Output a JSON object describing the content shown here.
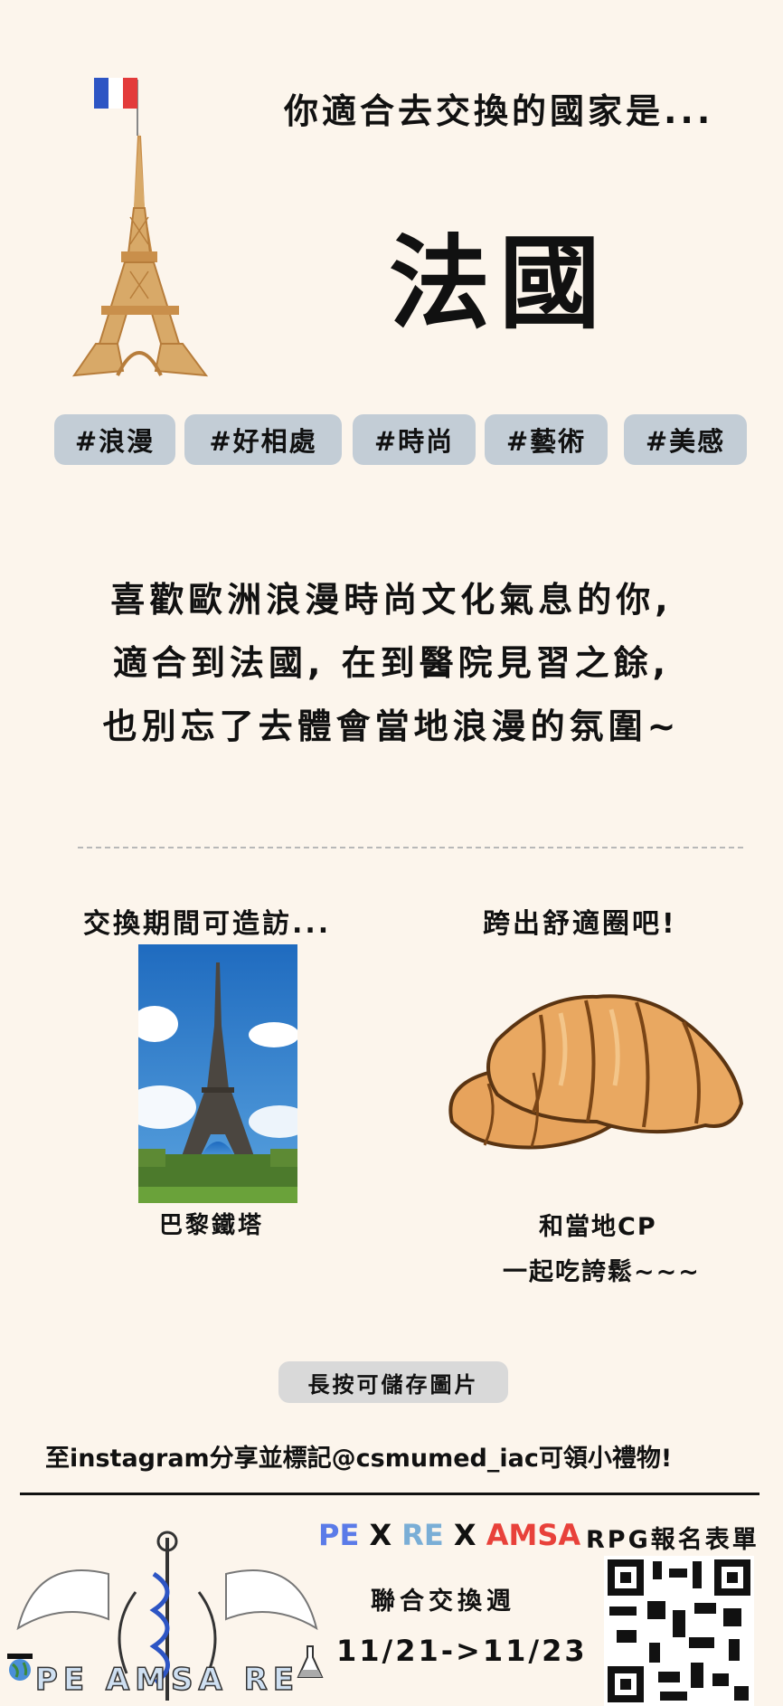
{
  "header": {
    "question": "你適合去交換的國家是...",
    "country": "法國"
  },
  "tags": [
    "#浪漫",
    "#好相處",
    "#時尚",
    "#藝術",
    "#美感"
  ],
  "description": {
    "lines": [
      "喜歡歐洲浪漫時尚文化氣息的你,",
      "適合到法國, 在到醫院見習之餘,",
      "也別忘了去體會當地浪漫的氛圍~"
    ]
  },
  "visit": {
    "heading": "交換期間可造訪...",
    "photo_caption": "巴黎鐵塔"
  },
  "comfort": {
    "heading": "跨出舒適圈吧!",
    "caption_line1": "和當地CP",
    "caption_line2": "一起吃誇鬆~~~"
  },
  "save_hint": "長按可儲存圖片",
  "share_text": "至instagram分享並標記@csmumed_iac可領小禮物!",
  "footer": {
    "title_pe": "PE",
    "title_x1": "X",
    "title_re": "RE",
    "title_x2": "X",
    "title_amsa": "AMSA",
    "event_name": "聯合交換週",
    "dates": "11/21->11/23",
    "rpg_label": "RPG報名表單",
    "logo_text": "PE AMSA RE"
  },
  "colors": {
    "background": "#fcf5ec",
    "tag_bg": "#c3cdd6",
    "pe_blue": "#5b7be8",
    "re_blue": "#7aaed6",
    "amsa_red": "#e8413a",
    "flag_blue": "#2d55c4",
    "flag_red": "#e33b3b",
    "tower_tan": "#d8a968"
  },
  "icons": [
    "france-flag-icon",
    "eiffel-tower-icon",
    "croissant-icon",
    "globe-icon",
    "flask-icon",
    "qr-code-icon"
  ]
}
